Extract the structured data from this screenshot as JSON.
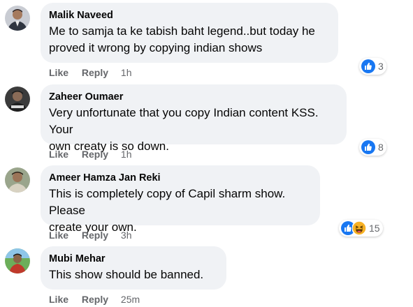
{
  "comments": [
    {
      "author": "Malik Naveed",
      "text_lines": [
        "Me to samja ta ke tabish baht legend..but today he",
        "proved it wrong by copying indian shows"
      ],
      "like_label": "Like",
      "reply_label": "Reply",
      "time": "1h",
      "reaction_count": "3",
      "reaction_icons": [
        "like-icon"
      ]
    },
    {
      "author": "Zaheer Oumaer",
      "text_lines": [
        "Very unfortunate that you copy Indian content KSS. Your",
        "own creaty is so down."
      ],
      "like_label": "Like",
      "reply_label": "Reply",
      "time": "1h",
      "reaction_count": "8",
      "reaction_icons": [
        "like-icon"
      ]
    },
    {
      "author": "Ameer Hamza Jan Reki",
      "text_lines": [
        "This is completely copy of Capil sharm show. Please",
        "create your own."
      ],
      "like_label": "Like",
      "reply_label": "Reply",
      "time": "3h",
      "reaction_count": "15",
      "reaction_icons": [
        "like-icon",
        "haha-icon"
      ]
    },
    {
      "author": "Mubi Mehar",
      "text_lines": [
        "This show should be banned."
      ],
      "like_label": "Like",
      "reply_label": "Reply",
      "time": "25m",
      "reaction_count": "",
      "reaction_icons": []
    }
  ],
  "colors": {
    "bubble_bg": "#f0f2f5",
    "like_blue": "#1877f2",
    "haha_yellow": "#f7b125",
    "meta_text": "#65676b"
  }
}
